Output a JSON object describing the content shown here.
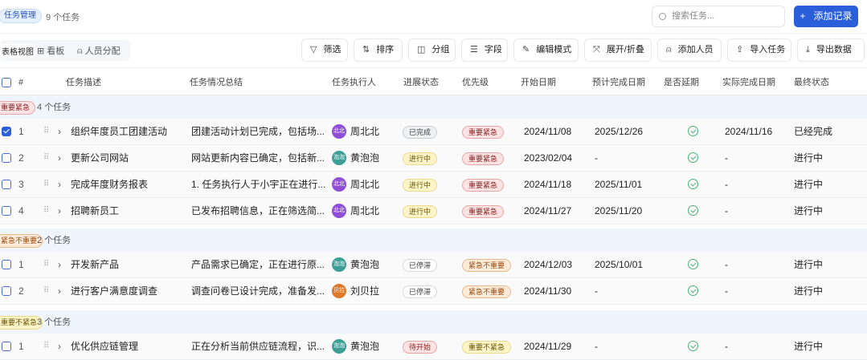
{
  "header": {
    "title_badge": "任务管理",
    "task_count": "9 个任务",
    "search_placeholder": "搜索任务...",
    "add_button": "添加记录"
  },
  "views": [
    {
      "label": "表格视图",
      "icon": "table-icon"
    },
    {
      "label": "看板",
      "icon": "kanban-icon"
    },
    {
      "label": "人员分配",
      "icon": "person-icon"
    }
  ],
  "views_visible": [
    "视图",
    "看板",
    "人员分配"
  ],
  "toolbar": [
    {
      "label": "筛选",
      "icon": "filter-icon",
      "glyph": "▽"
    },
    {
      "label": "排序",
      "icon": "sort-icon",
      "glyph": "⇅"
    },
    {
      "label": "分组",
      "icon": "group-icon",
      "glyph": "◫"
    },
    {
      "label": "字段",
      "icon": "fields-icon",
      "glyph": "☰"
    },
    {
      "label": "编辑模式",
      "icon": "pencil-icon",
      "glyph": "✎"
    },
    {
      "label": "展开/折叠",
      "icon": "expand-icon",
      "glyph": "⤧"
    },
    {
      "label": "添加人员",
      "icon": "person-icon",
      "glyph": "⍝"
    },
    {
      "label": "导入任务",
      "icon": "upload-icon",
      "glyph": "⇪"
    },
    {
      "label": "导出数据",
      "icon": "download-icon",
      "glyph": "⤓"
    }
  ],
  "columns": [
    "#",
    "任务描述",
    "任务情况总结",
    "任务执行人",
    "进展状态",
    "优先级",
    "开始日期",
    "预计完成日期",
    "是否延期",
    "实际完成日期",
    "最终状态"
  ],
  "colors": {
    "accent": "#2b5fd9",
    "group_bg": "#eef5fd"
  },
  "groups": [
    {
      "label": "重要紧急",
      "count": "4 个任务",
      "style": "red",
      "rows": [
        {
          "num": "1",
          "checked": true,
          "desc": "组织年度员工团建活动",
          "summary": "团建活动计划已完成，包括场...",
          "avatar": "北北",
          "avatar_color": "#8e4fd6",
          "assignee": "周北北",
          "progress": "已完成",
          "progress_style": "gray",
          "priority": "重要紧急",
          "priority_style": "red",
          "start": "2024/11/08",
          "due": "2025/12/26",
          "actual": "2024/11/16",
          "final": "已经完成"
        },
        {
          "num": "2",
          "checked": false,
          "desc": "更新公司网站",
          "summary": "网站更新内容已确定，包括新...",
          "avatar": "泡泡",
          "avatar_color": "#3b9f96",
          "assignee": "黄泡泡",
          "progress": "进行中",
          "progress_style": "yellow",
          "priority": "重要紧急",
          "priority_style": "red",
          "start": "2023/02/04",
          "due": "-",
          "actual": "-",
          "final": "进行中"
        },
        {
          "num": "3",
          "checked": false,
          "desc": "完成年度财务报表",
          "summary": "1. 任务执行人于小宇正在进行...",
          "avatar": "北北",
          "avatar_color": "#8e4fd6",
          "assignee": "周北北",
          "progress": "进行中",
          "progress_style": "yellow",
          "priority": "重要紧急",
          "priority_style": "red",
          "start": "2024/11/18",
          "due": "2025/11/01",
          "actual": "-",
          "final": "进行中"
        },
        {
          "num": "4",
          "checked": false,
          "desc": "招聘新员工",
          "summary": "已发布招聘信息，正在筛选简...",
          "avatar": "北北",
          "avatar_color": "#8e4fd6",
          "assignee": "周北北",
          "progress": "进行中",
          "progress_style": "yellow",
          "priority": "重要紧急",
          "priority_style": "red",
          "start": "2024/11/27",
          "due": "2025/11/20",
          "actual": "-",
          "final": "进行中"
        }
      ]
    },
    {
      "label": "紧急不重要",
      "count": "2 个任务",
      "style": "orange",
      "rows": [
        {
          "num": "1",
          "checked": false,
          "desc": "开发新产品",
          "summary": "产品需求已确定，正在进行原...",
          "avatar": "泡泡",
          "avatar_color": "#3b9f96",
          "assignee": "黄泡泡",
          "progress": "已停滞",
          "progress_style": "white",
          "priority": "紧急不重要",
          "priority_style": "orange",
          "start": "2024/12/03",
          "due": "2025/10/01",
          "actual": "-",
          "final": "进行中"
        },
        {
          "num": "2",
          "checked": false,
          "desc": "进行客户满意度调查",
          "summary": "调查问卷已设计完成，准备发...",
          "avatar": "贝拉",
          "avatar_color": "#e0782a",
          "assignee": "刘贝拉",
          "progress": "已停滞",
          "progress_style": "white",
          "priority": "紧急不重要",
          "priority_style": "orange",
          "start": "2024/11/30",
          "due": "-",
          "actual": "-",
          "final": "进行中"
        }
      ]
    },
    {
      "label": "重要不紧急",
      "count": "3 个任务",
      "style": "yellow",
      "rows": [
        {
          "num": "1",
          "checked": false,
          "desc": "优化供应链管理",
          "summary": "正在分析当前供应链流程，识...",
          "avatar": "泡泡",
          "avatar_color": "#3b9f96",
          "assignee": "黄泡泡",
          "progress": "待开始",
          "progress_style": "red",
          "priority": "重要不紧急",
          "priority_style": "yellow",
          "start": "2024/11/29",
          "due": "-",
          "actual": "-",
          "final": "进行中"
        }
      ]
    }
  ]
}
